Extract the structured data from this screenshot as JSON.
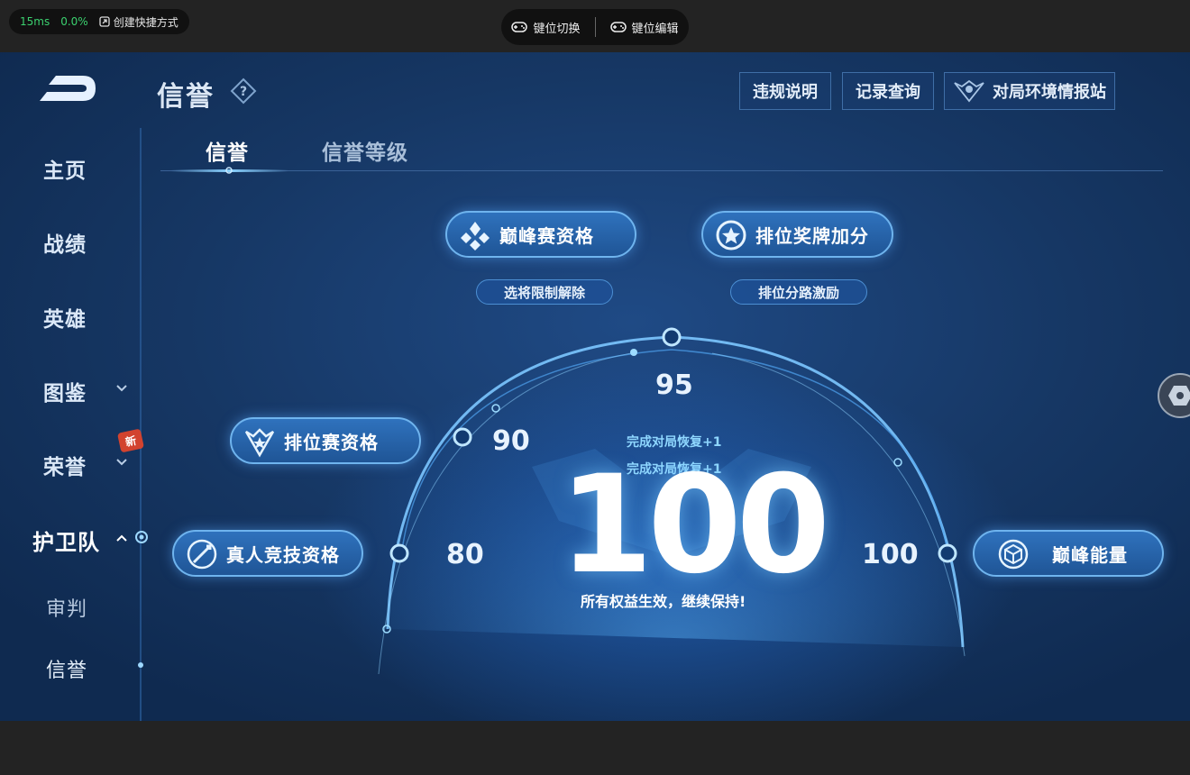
{
  "topbar": {
    "latency": "15ms",
    "loss": "0.0%",
    "shortcut_label": "创建快捷方式",
    "key_switch": "键位切换",
    "key_edit": "键位编辑"
  },
  "header": {
    "title": "信誉",
    "buttons": [
      "违规说明",
      "记录查询",
      "对局环境情报站"
    ]
  },
  "sidebar": {
    "items": [
      "主页",
      "战绩",
      "英雄",
      "图鉴",
      "荣誉",
      "护卫队",
      "审判",
      "信誉"
    ],
    "new_badge": "新"
  },
  "tabs": [
    "信誉",
    "信誉等级"
  ],
  "privileges": {
    "peak_qual": "巅峰赛资格",
    "peak_qual_sub": "选将限制解除",
    "rank_medal": "排位奖牌加分",
    "rank_medal_sub": "排位分路激励",
    "rank_qual": "排位赛资格",
    "human_qual": "真人竞技资格",
    "peak_energy": "巅峰能量"
  },
  "gauge": {
    "mark_95": "95",
    "mark_90": "90",
    "mark_80": "80",
    "mark_100": "100",
    "score": "100",
    "recover_1": "完成对局恢复+1",
    "recover_2": "完成对局恢复+1",
    "status": "所有权益生效，继续保持!"
  },
  "colors": {
    "accent": "#6fb4ee",
    "background": "#163764",
    "badge": "#d2432f"
  }
}
